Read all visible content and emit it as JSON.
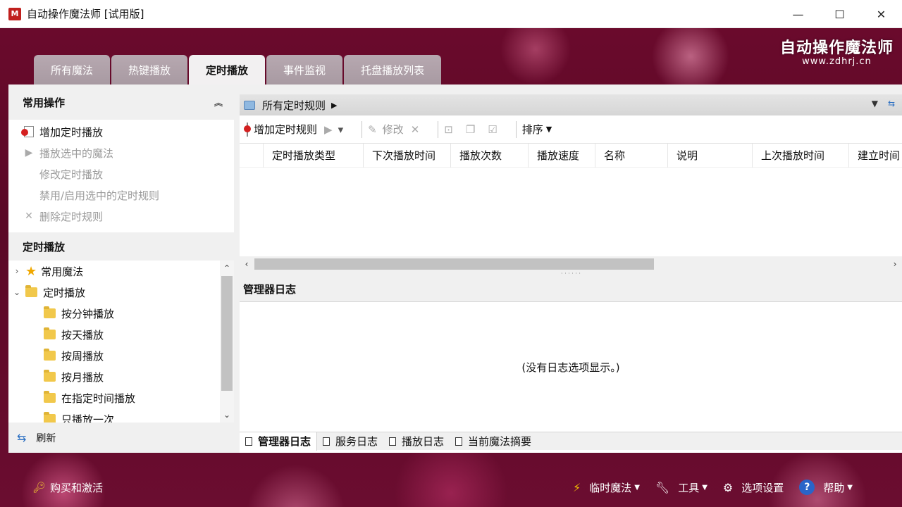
{
  "window": {
    "title": "自动操作魔法师 [试用版]",
    "app_icon_letter": "M",
    "minimize": "—",
    "maximize": "☐",
    "close": "✕"
  },
  "brand": {
    "name": "自动操作魔法师",
    "url": "www.zdhrj.cn"
  },
  "tabs": [
    {
      "label": "所有魔法",
      "active": false
    },
    {
      "label": "热键播放",
      "active": false
    },
    {
      "label": "定时播放",
      "active": true
    },
    {
      "label": "事件监视",
      "active": false
    },
    {
      "label": "托盘播放列表",
      "active": false
    }
  ],
  "left_panel": {
    "common_ops_title": "常用操作",
    "ops": [
      {
        "label": "增加定时播放",
        "enabled": true,
        "icon": "add-doc-icon"
      },
      {
        "label": "播放选中的魔法",
        "enabled": false,
        "icon": "play-icon"
      },
      {
        "label": "修改定时播放",
        "enabled": false,
        "icon": ""
      },
      {
        "label": "禁用/启用选中的定时规则",
        "enabled": false,
        "icon": ""
      },
      {
        "label": "删除定时规则",
        "enabled": false,
        "icon": "delete-icon"
      }
    ],
    "schedule_title": "定时播放",
    "tree": [
      {
        "label": "常用魔法",
        "level": 0,
        "expander": "›",
        "icon": "star-icon"
      },
      {
        "label": "定时播放",
        "level": 0,
        "expander": "⌄",
        "icon": "folder-icon"
      },
      {
        "label": "按分钟播放",
        "level": 1,
        "icon": "folder-icon"
      },
      {
        "label": "按天播放",
        "level": 1,
        "icon": "folder-icon"
      },
      {
        "label": "按周播放",
        "level": 1,
        "icon": "folder-icon"
      },
      {
        "label": "按月播放",
        "level": 1,
        "icon": "folder-icon"
      },
      {
        "label": "在指定时间播放",
        "level": 1,
        "icon": "folder-icon"
      },
      {
        "label": "只播放一次",
        "level": 1,
        "icon": "folder-icon"
      }
    ],
    "refresh_label": "刷新"
  },
  "main": {
    "path_label": "所有定时规则",
    "toolbar": {
      "add_rule": "增加定时规则",
      "edit": "修改",
      "sort": "排序"
    },
    "columns": [
      "定时播放类型",
      "下次播放时间",
      "播放次数",
      "播放速度",
      "名称",
      "说明",
      "上次播放时间",
      "建立时间"
    ],
    "log_title": "管理器日志",
    "log_empty": "(没有日志选项显示。)",
    "log_tabs": [
      "管理器日志",
      "服务日志",
      "播放日志",
      "当前魔法摘要"
    ]
  },
  "footer": {
    "buy": "购买和激活",
    "temp_magic": "临时魔法",
    "tools": "工具",
    "options": "选项设置",
    "help": "帮助"
  }
}
